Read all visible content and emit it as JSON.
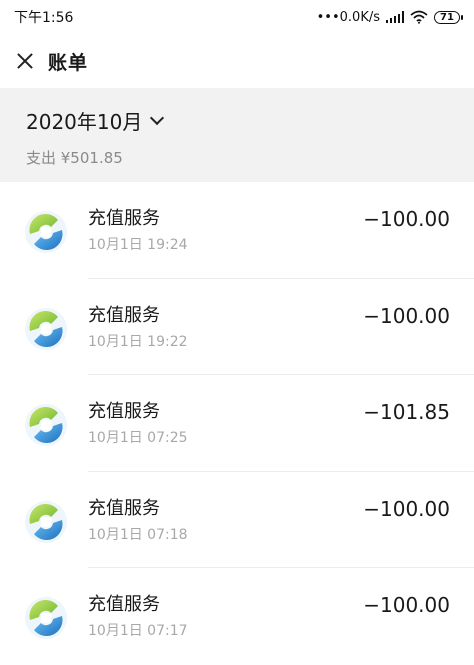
{
  "status_bar": {
    "time": "下午1:56",
    "network_speed": "•••0.0K/s",
    "battery": "71"
  },
  "header": {
    "title": "账单"
  },
  "summary": {
    "month": "2020年10月",
    "spending": "支出 ¥501.85"
  },
  "transactions": [
    {
      "title": "充值服务",
      "time": "10月1日 19:24",
      "amount": "−100.00"
    },
    {
      "title": "充值服务",
      "time": "10月1日 19:22",
      "amount": "−100.00"
    },
    {
      "title": "充值服务",
      "time": "10月1日 07:25",
      "amount": "−101.85"
    },
    {
      "title": "充值服务",
      "time": "10月1日 07:18",
      "amount": "−100.00"
    },
    {
      "title": "充值服务",
      "time": "10月1日 07:17",
      "amount": "−100.00"
    }
  ],
  "icons": {
    "close": "close-icon",
    "month_picker": "chevron-down-icon",
    "merchant": "merchant-logo-icon"
  },
  "colors": {
    "summary_background": "#f2f2f2",
    "secondary_text": "#a8a8a8",
    "logo_green": "#8cc63f",
    "logo_blue": "#2a8fd6"
  }
}
